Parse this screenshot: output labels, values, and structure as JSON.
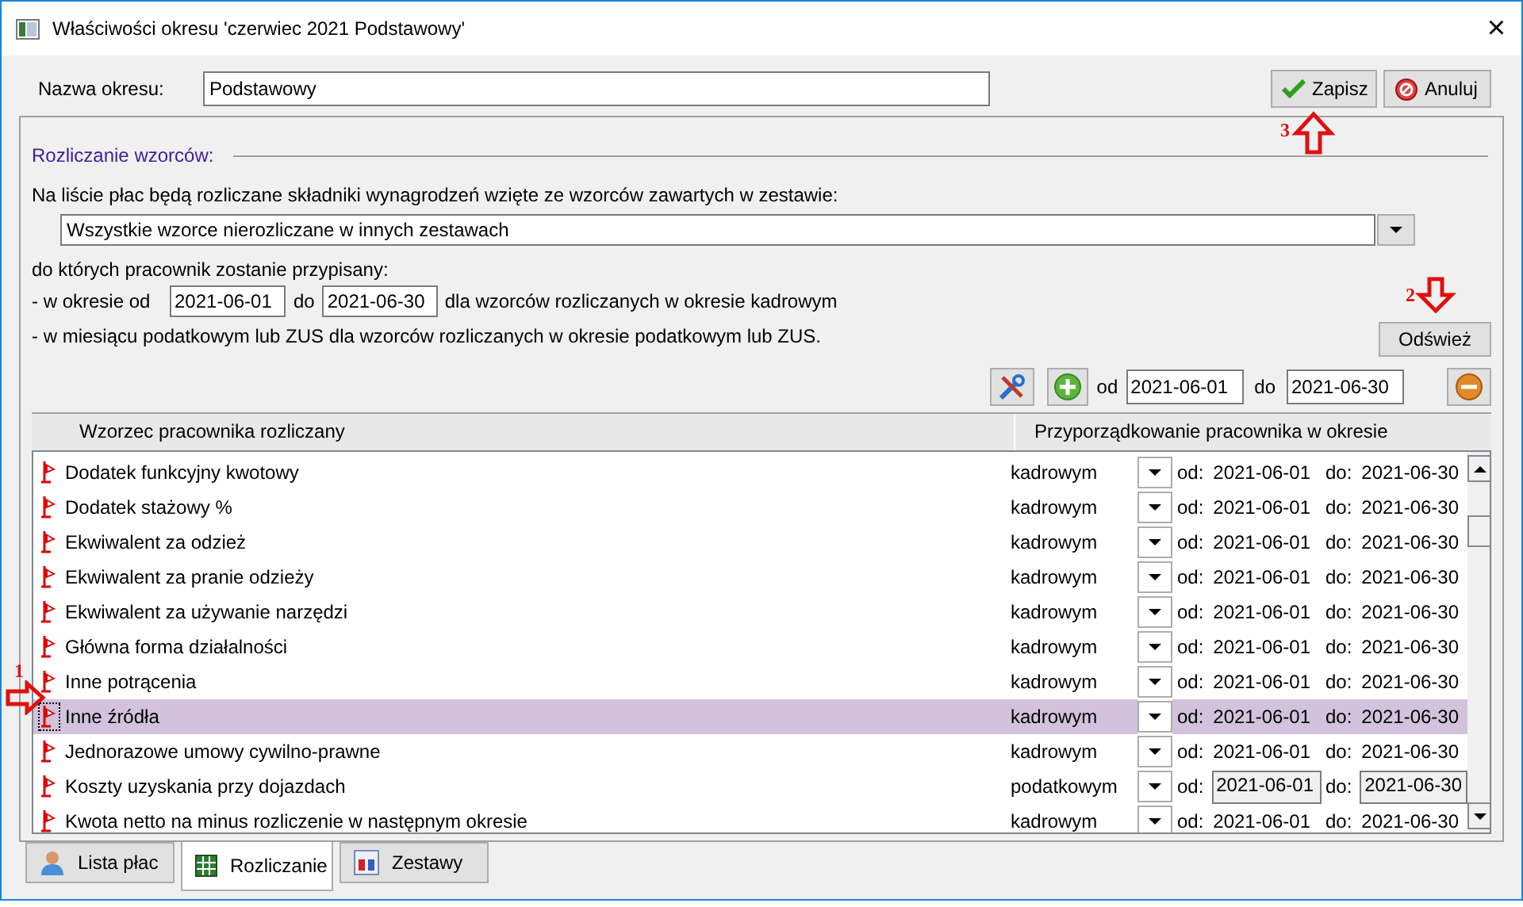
{
  "window": {
    "title": "Właściwości okresu 'czerwiec 2021 Podstawowy'",
    "close": "×"
  },
  "name_field": {
    "label": "Nazwa okresu:",
    "value": "Podstawowy"
  },
  "buttons": [
    {
      "kind": "save",
      "label": "Zapisz"
    },
    {
      "kind": "cancel",
      "label": "Anuluj"
    }
  ],
  "section": {
    "title": "Rozliczanie wzorców:",
    "intro": "Na liście płac będą rozliczane składniki wynagrodzeń wzięte ze wzorców zawartych w zestawie:",
    "set_select": "Wszystkie wzorce nierozliczane w innych zestawach",
    "assign_text": "do których pracownik zostanie przypisany:",
    "period_prefix": "- w okresie od",
    "period_from": "2021-06-01",
    "period_mid": "do",
    "period_to": "2021-06-30",
    "period_suffix": "dla wzorców rozliczanych w okresie kadrowym",
    "tax_text": "- w miesiącu podatkowym lub ZUS dla wzorców rozliczanych w okresie podatkowym lub ZUS.",
    "refresh": "Odśwież"
  },
  "toolbar": {
    "from_label": "od",
    "from": "2021-06-01",
    "to_label": "do",
    "to": "2021-06-30"
  },
  "table": {
    "columns": [
      "Wzorzec pracownika rozliczany",
      "Przyporządkowanie pracownika w okresie"
    ],
    "rows": [
      {
        "name": "Dodatek funkcyjny kwotowy",
        "period": "kadrowym",
        "od_label": "od:",
        "od": "2021-06-01",
        "do_label": "do:",
        "do": "2021-06-30",
        "selected": false,
        "dates_boxed": false
      },
      {
        "name": "Dodatek stażowy %",
        "period": "kadrowym",
        "od_label": "od:",
        "od": "2021-06-01",
        "do_label": "do:",
        "do": "2021-06-30",
        "selected": false,
        "dates_boxed": false
      },
      {
        "name": "Ekwiwalent za odzież",
        "period": "kadrowym",
        "od_label": "od:",
        "od": "2021-06-01",
        "do_label": "do:",
        "do": "2021-06-30",
        "selected": false,
        "dates_boxed": false
      },
      {
        "name": "Ekwiwalent za pranie odzieży",
        "period": "kadrowym",
        "od_label": "od:",
        "od": "2021-06-01",
        "do_label": "do:",
        "do": "2021-06-30",
        "selected": false,
        "dates_boxed": false
      },
      {
        "name": "Ekwiwalent za używanie narzędzi",
        "period": "kadrowym",
        "od_label": "od:",
        "od": "2021-06-01",
        "do_label": "do:",
        "do": "2021-06-30",
        "selected": false,
        "dates_boxed": false
      },
      {
        "name": "Główna forma działalności",
        "period": "kadrowym",
        "od_label": "od:",
        "od": "2021-06-01",
        "do_label": "do:",
        "do": "2021-06-30",
        "selected": false,
        "dates_boxed": false
      },
      {
        "name": "Inne potrącenia",
        "period": "kadrowym",
        "od_label": "od:",
        "od": "2021-06-01",
        "do_label": "do:",
        "do": "2021-06-30",
        "selected": false,
        "dates_boxed": false
      },
      {
        "name": "Inne źródła",
        "period": "kadrowym",
        "od_label": "od:",
        "od": "2021-06-01",
        "do_label": "do:",
        "do": "2021-06-30",
        "selected": true,
        "dates_boxed": false
      },
      {
        "name": "Jednorazowe umowy cywilno-prawne",
        "period": "kadrowym",
        "od_label": "od:",
        "od": "2021-06-01",
        "do_label": "do:",
        "do": "2021-06-30",
        "selected": false,
        "dates_boxed": false
      },
      {
        "name": "Koszty uzyskania przy dojazdach",
        "period": "podatkowym",
        "od_label": "od:",
        "od": "2021-06-01",
        "do_label": "do:",
        "do": "2021-06-30",
        "selected": false,
        "dates_boxed": true
      },
      {
        "name": "Kwota netto na minus rozliczenie w następnym okresie",
        "period": "kadrowym",
        "od_label": "od:",
        "od": "2021-06-01",
        "do_label": "do:",
        "do": "2021-06-30",
        "selected": false,
        "dates_boxed": false
      }
    ]
  },
  "tabs": [
    {
      "label": "Lista płac",
      "kind": "person",
      "selected": false
    },
    {
      "label": "Rozliczanie",
      "kind": "sheet",
      "selected": true
    },
    {
      "label": "Zestawy",
      "kind": "set",
      "selected": false
    }
  ],
  "annotations": [
    {
      "label": "1",
      "kind": "right"
    },
    {
      "label": "2",
      "kind": "down"
    },
    {
      "label": "3",
      "kind": "up"
    }
  ]
}
